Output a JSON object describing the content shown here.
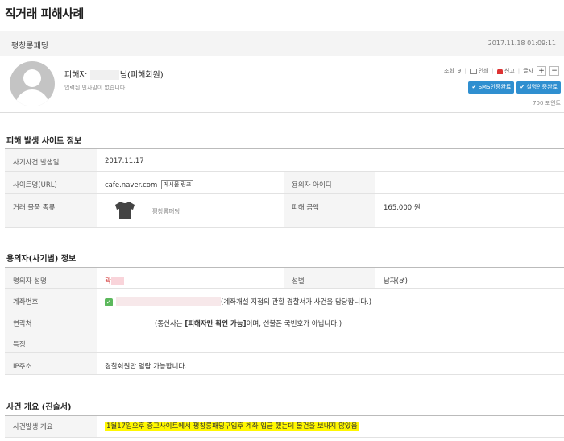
{
  "page": {
    "title": "직거래 피해사례"
  },
  "post": {
    "subject": "평창롱패딩",
    "datetime": "2017.11.18 01:09:11",
    "author_prefix": "피해자",
    "author_suffix": "님(피해회원)",
    "author_intro": "입력된 인사말이 없습니다.",
    "views_label": "조회",
    "views": "9",
    "print_label": "인쇄",
    "report_label": "신고",
    "font_label": "글자",
    "font_plus": "+",
    "font_minus": "−",
    "badge_sms": "SMS인증완료",
    "badge_realname": "실명인증완료",
    "points": "700 포인트"
  },
  "site_section": {
    "title": "피해 발생 사이트 정보",
    "date_label": "사기사건 발생일",
    "date_value": "2017.11.17",
    "url_label": "사이트명(URL)",
    "url_value": "cafe.naver.com",
    "url_link_label": "게시물 링크",
    "suspect_id_label": "용의자 아이디",
    "suspect_id_value": "",
    "item_type_label": "거래 물품 종류",
    "item_name": "평창롱패딩",
    "amount_label": "피해 금액",
    "amount_value": "165,000 원"
  },
  "suspect_section": {
    "title": "용의자(사기범) 정보",
    "name_label": "명의자 성명",
    "name_value": "곽",
    "gender_label": "성별",
    "gender_value": "남자(♂)",
    "account_label": "계좌번호",
    "account_note": "(계좌개설 지점의 관할 경찰서가 사건을 담당합니다.)",
    "contact_label": "연락처",
    "contact_note_pre": "(통신사는 ",
    "contact_note_bold": "[피해자만 확인 가능]",
    "contact_note_post": "이며, 선불폰 국번호가 아닙니다.)",
    "feature_label": "특징",
    "feature_value": "",
    "ip_label": "IP주소",
    "ip_value": "경찰회원만 열람 가능합니다."
  },
  "statement_section": {
    "title": "사건 개요 (진술서)",
    "summary_label": "사건발생 개요",
    "summary_value": "1월17일오후 중고사이트에서 평창롱패딩구입후 계좌 입금 했는데 물건을 보내지 않았음"
  },
  "colors": {
    "badge": "#2f8fd0",
    "highlight": "#fff700",
    "warning": "#d64545",
    "check": "#5cb85c"
  }
}
